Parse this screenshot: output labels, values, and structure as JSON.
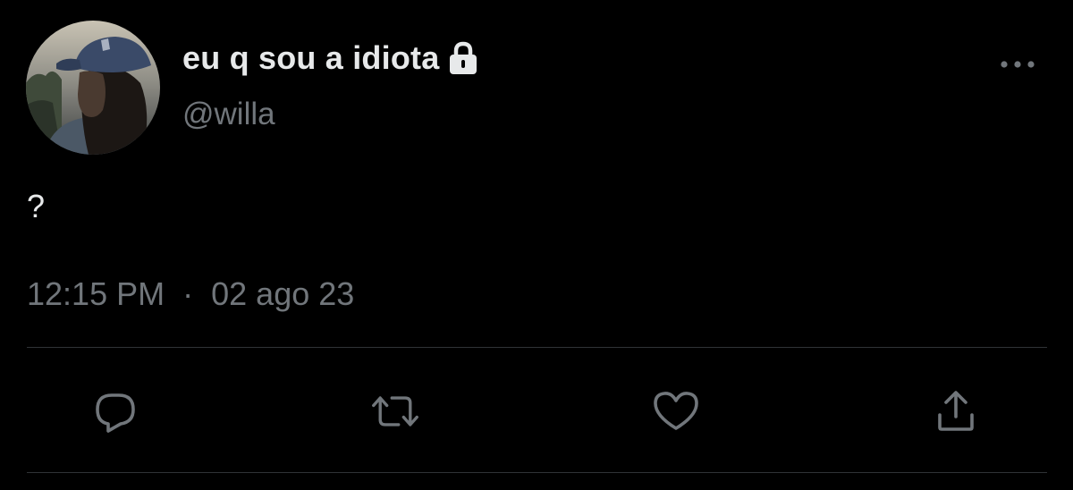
{
  "tweet": {
    "display_name": "eu q sou a idiota",
    "handle": "@willa",
    "text": "?",
    "time": "12:15 PM",
    "separator": "·",
    "date": "02 ago 23"
  },
  "icons": {
    "protected": "lock-icon",
    "more": "more-options-icon",
    "reply": "reply-icon",
    "retweet": "retweet-icon",
    "like": "heart-icon",
    "share": "share-icon"
  },
  "colors": {
    "background": "#000000",
    "primary_text": "#e7e9ea",
    "secondary_text": "#71767b",
    "divider": "#2f3336"
  }
}
